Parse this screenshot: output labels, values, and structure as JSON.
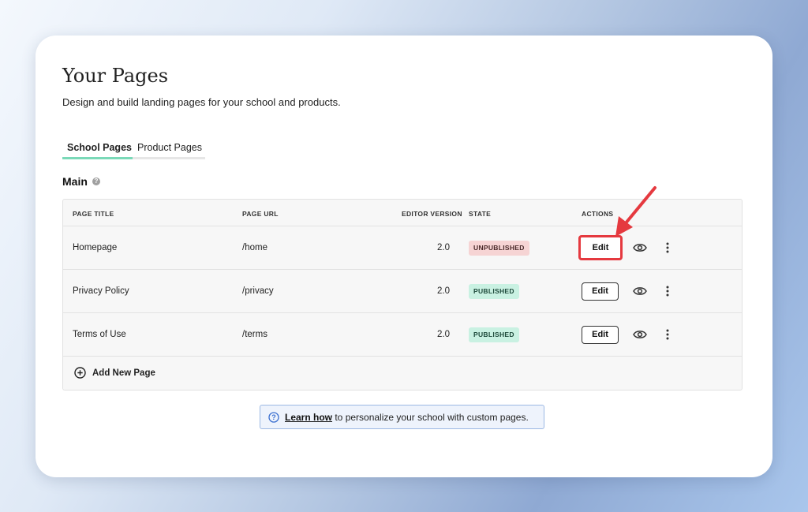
{
  "page": {
    "title": "Your Pages",
    "subtitle": "Design and build landing pages for your school and products."
  },
  "tabs": [
    {
      "label": "School Pages",
      "active": true
    },
    {
      "label": "Product Pages",
      "active": false
    }
  ],
  "section": {
    "title": "Main",
    "icon": "help-circle-icon"
  },
  "table": {
    "headers": [
      "PAGE TITLE",
      "PAGE URL",
      "EDITOR VERSION",
      "STATE",
      "ACTIONS"
    ],
    "rows": [
      {
        "title": "Homepage",
        "url": "/home",
        "version": "2.0",
        "state": "UNPUBLISHED",
        "action": "Edit"
      },
      {
        "title": "Privacy Policy",
        "url": "/privacy",
        "version": "2.0",
        "state": "PUBLISHED",
        "action": "Edit"
      },
      {
        "title": "Terms of Use",
        "url": "/terms",
        "version": "2.0",
        "state": "PUBLISHED",
        "action": "Edit"
      }
    ],
    "add_label": "Add New Page"
  },
  "info": {
    "link": "Learn how",
    "text": " to personalize your school with custom pages."
  },
  "colors": {
    "accent": "#7ad9b8",
    "highlight": "#e5393f",
    "unpublished_bg": "#f6d4d4",
    "published_bg": "#c9f1e2"
  }
}
